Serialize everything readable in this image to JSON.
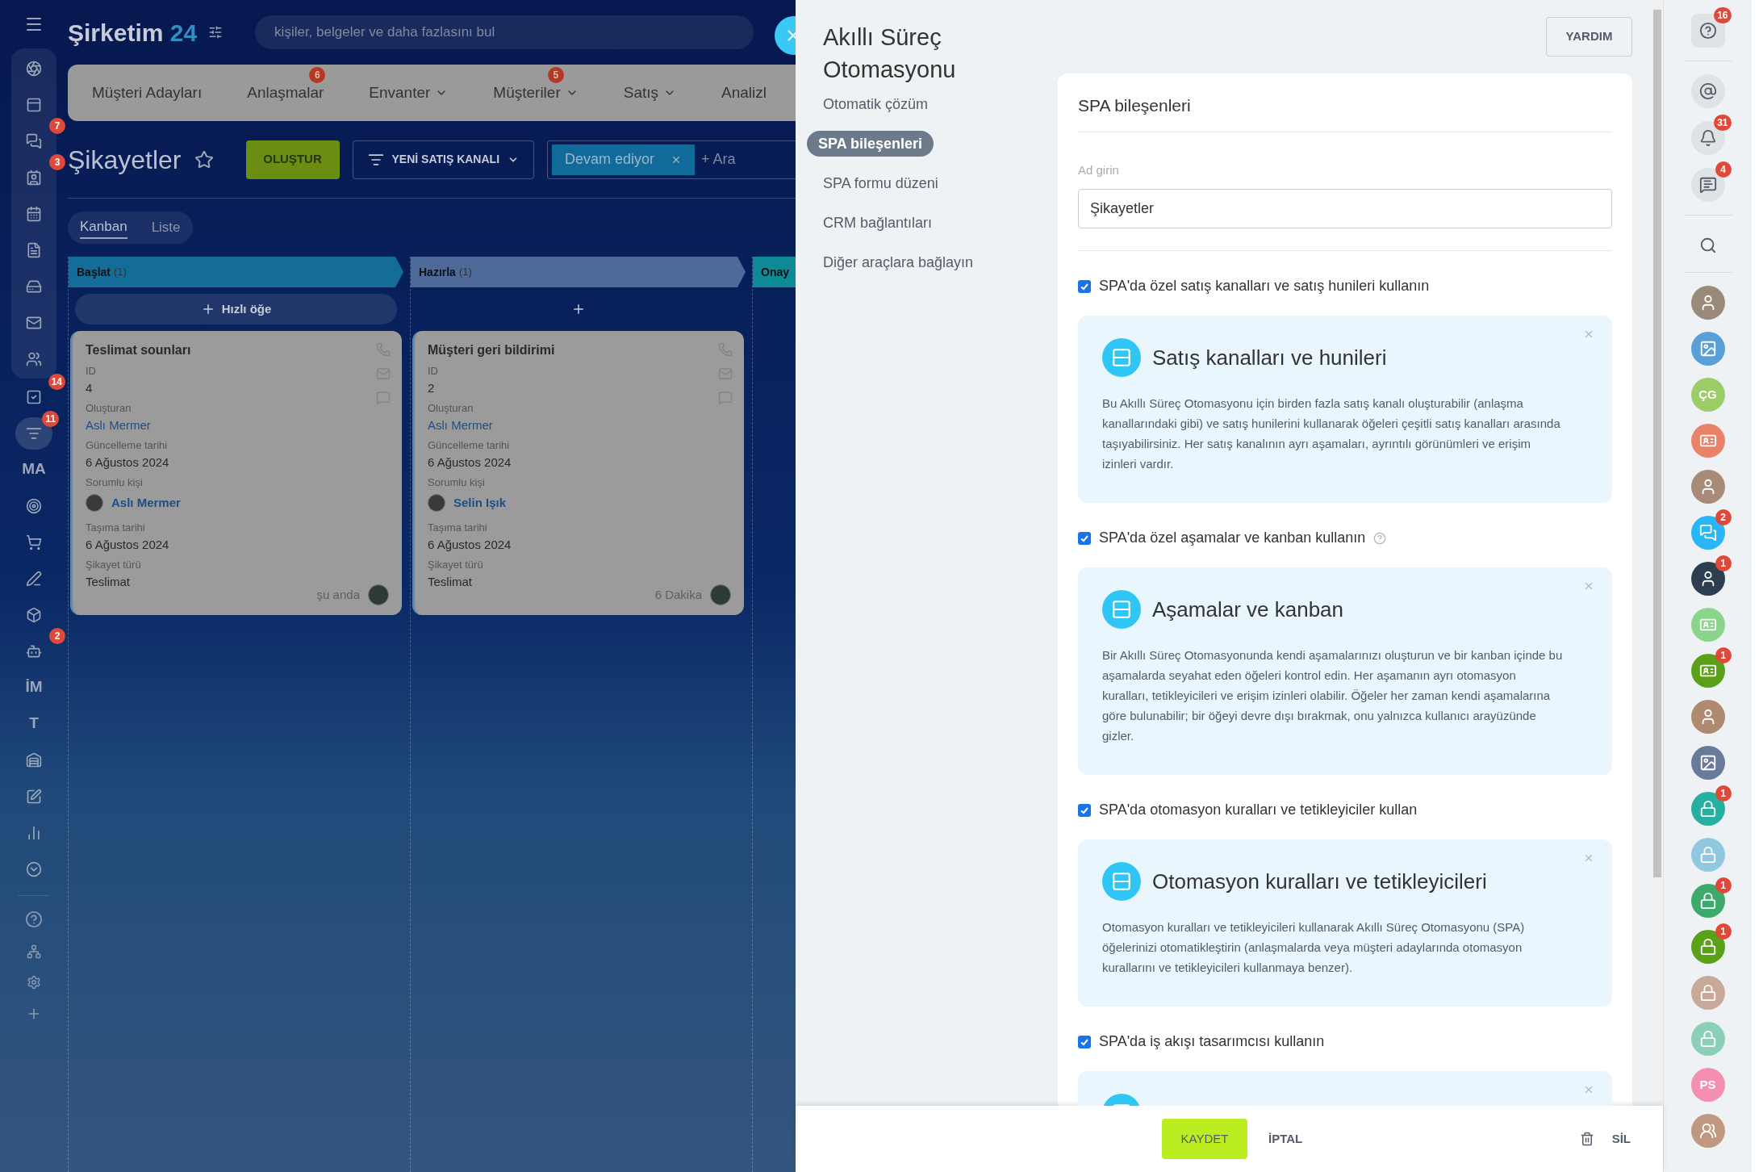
{
  "app": {
    "brand": {
      "name": "Şirketim",
      "number": "24"
    },
    "search": {
      "placeholder": "kişiler, belgeler ve daha fazlasını bul"
    },
    "left_nav": [
      {
        "kind": "icon",
        "selected": false
      },
      {
        "kind": "icon",
        "selected": false
      },
      {
        "kind": "icon",
        "badge": "7",
        "selected": false
      },
      {
        "kind": "icon",
        "badge": "3",
        "selected": false
      },
      {
        "kind": "icon",
        "selected": false
      },
      {
        "kind": "icon",
        "selected": false
      },
      {
        "kind": "icon",
        "selected": false
      },
      {
        "kind": "icon",
        "selected": false
      },
      {
        "kind": "icon",
        "selected": false
      },
      {
        "kind": "icon",
        "badge": "14",
        "selected": false
      },
      {
        "kind": "icon",
        "badge": "11",
        "selected": true
      },
      {
        "kind": "text",
        "text": "MA",
        "selected": false
      },
      {
        "kind": "icon",
        "selected": false
      },
      {
        "kind": "icon",
        "selected": false
      },
      {
        "kind": "icon",
        "selected": false
      },
      {
        "kind": "icon",
        "selected": false
      },
      {
        "kind": "icon",
        "badge": "2",
        "selected": false
      },
      {
        "kind": "text",
        "text": "İM",
        "selected": false
      },
      {
        "kind": "text",
        "text": "T",
        "selected": false
      },
      {
        "kind": "icon",
        "selected": false
      },
      {
        "kind": "icon",
        "selected": false
      },
      {
        "kind": "icon",
        "selected": false
      },
      {
        "kind": "icon",
        "selected": false
      }
    ],
    "top_menu": [
      {
        "label": "Müşteri Adayları",
        "dropdown": false
      },
      {
        "label": "Anlaşmalar",
        "badge": "6",
        "dropdown": false
      },
      {
        "label": "Envanter",
        "dropdown": true
      },
      {
        "label": "Müşteriler",
        "badge": "5",
        "dropdown": true
      },
      {
        "label": "Satış",
        "dropdown": true
      },
      {
        "label": "Analizl",
        "dropdown": false
      }
    ],
    "page_title": "Şikayetler",
    "create_button": "OLUŞTUR",
    "pipeline_button": "YENİ SATIŞ KANALI",
    "filter": {
      "chip": "Devam ediyor",
      "placeholder": "+ Ara"
    },
    "views": [
      {
        "label": "Kanban",
        "selected": true
      },
      {
        "label": "Liste",
        "selected": false
      }
    ],
    "columns": [
      {
        "title": "Başlat",
        "count": "(1)",
        "color": "#146c98",
        "quick_add": "Hızlı öğe",
        "cards": [
          {
            "title": "Teslimat sounları",
            "fields": [
              {
                "label": "ID",
                "value": "4",
                "kind": "text"
              },
              {
                "label": "Oluşturan",
                "value": "Aslı Mermer",
                "kind": "link"
              },
              {
                "label": "Güncelleme tarihi",
                "value": "6 Ağustos 2024",
                "kind": "text"
              },
              {
                "label": "Sorumlu kişi",
                "value": "Aslı Mermer",
                "kind": "person"
              },
              {
                "label": "Taşıma tarihi",
                "value": "6 Ağustos 2024",
                "kind": "text"
              },
              {
                "label": "Şikayet türü",
                "value": "Teslimat",
                "kind": "text"
              }
            ],
            "time": "şu anda"
          }
        ]
      },
      {
        "title": "Hazırla",
        "count": "(1)",
        "color": "#4d6a9a",
        "cards": [
          {
            "title": "Müşteri geri bildirimi",
            "fields": [
              {
                "label": "ID",
                "value": "2",
                "kind": "text"
              },
              {
                "label": "Oluşturan",
                "value": "Aslı Mermer",
                "kind": "link"
              },
              {
                "label": "Güncelleme tarihi",
                "value": "6 Ağustos 2024",
                "kind": "text"
              },
              {
                "label": "Sorumlu kişi",
                "value": "Selin Işık",
                "kind": "person"
              },
              {
                "label": "Taşıma tarihi",
                "value": "6 Ağustos 2024",
                "kind": "text"
              },
              {
                "label": "Şikayet türü",
                "value": "Teslimat",
                "kind": "text"
              }
            ],
            "time": "6 Dakika"
          }
        ]
      },
      {
        "title": "Onay",
        "color": "#0e8a96"
      }
    ]
  },
  "panel": {
    "title": "Akıllı Süreç Otomasyonu",
    "nav": [
      {
        "label": "Otomatik çözüm",
        "selected": false
      },
      {
        "label": "SPA bileşenleri",
        "selected": true
      },
      {
        "label": "SPA formu düzeni",
        "selected": false
      },
      {
        "label": "CRM bağlantıları",
        "selected": false
      },
      {
        "label": "Diğer araçlara bağlayın",
        "selected": false
      }
    ],
    "help_button": "YARDIM",
    "section_title": "SPA bileşenleri",
    "name_field": {
      "label": "Ad girin",
      "value": "Şikayetler"
    },
    "options": [
      {
        "label": "SPA'da özel satış kanalları ve satış hunileri kullanın",
        "checked": true,
        "help": false,
        "info": {
          "title": "Satış kanalları ve hunileri",
          "text": "Bu Akıllı Süreç Otomasyonu için birden fazla satış kanalı oluşturabilir (anlaşma kanallarındaki gibi) ve satış hunilerini kullanarak öğeleri çeşitli satış kanalları arasında taşıyabilirsiniz. Her satış kanalının ayrı aşamaları, ayrıntılı görünümleri ve erişim izinleri vardır."
        }
      },
      {
        "label": "SPA'da özel aşamalar ve kanban kullanın",
        "checked": true,
        "help": true,
        "info": {
          "title": "Aşamalar ve kanban",
          "text": "Bir Akıllı Süreç Otomasyonunda kendi aşamalarınızı oluşturun ve bir kanban içinde bu aşamalarda seyahat eden öğeleri kontrol edin. Her aşamanın ayrı otomasyon kuralları, tetikleyicileri ve erişim izinleri olabilir. Öğeler her zaman kendi aşamalarına göre bulunabilir; bir öğeyi devre dışı bırakmak, onu yalnızca kullanıcı arayüzünde gizler."
        }
      },
      {
        "label": "SPA'da otomasyon kuralları ve tetikleyiciler kullan",
        "checked": true,
        "help": false,
        "info": {
          "title": "Otomasyon kuralları ve tetikleyicileri",
          "text": "Otomasyon kuralları ve tetikleyicileri kullanarak Akıllı Süreç Otomasyonu (SPA) öğelerinizi otomatikleştirin (anlaşmalarda veya müşteri adaylarında otomasyon kurallarını ve tetikleyicileri kullanmaya benzer)."
        }
      },
      {
        "label": "SPA'da iş akışı tasarımcısı kullanın",
        "checked": true,
        "help": false,
        "info": {
          "partial": true
        }
      }
    ],
    "footer": {
      "save": "KAYDET",
      "cancel": "İPTAL",
      "delete": "SİL"
    }
  },
  "right_bar": {
    "top_badges": {
      "help": "16",
      "notifications": "31",
      "chats": "4"
    },
    "contacts": [
      {
        "kind": "avatar",
        "color": "#9a8a7a"
      },
      {
        "kind": "picture",
        "color": "#5aa0d8"
      },
      {
        "kind": "initials",
        "text": "ÇG",
        "color": "#9ccc65"
      },
      {
        "kind": "card",
        "color": "#e8836a"
      },
      {
        "kind": "avatar",
        "color": "#a88a78"
      },
      {
        "kind": "chat",
        "color": "#29b6f6",
        "badge": "2"
      },
      {
        "kind": "avatar",
        "color": "#2c3e50",
        "badge": "1"
      },
      {
        "kind": "card",
        "color": "#8bd48b"
      },
      {
        "kind": "card",
        "color": "#5aa018",
        "badge": "1"
      },
      {
        "kind": "avatar",
        "color": "#b08a70"
      },
      {
        "kind": "picture",
        "color": "#6a7a9a"
      },
      {
        "kind": "lock",
        "color": "#26b0a0",
        "badge": "1"
      },
      {
        "kind": "lock",
        "color": "#90c8e0"
      },
      {
        "kind": "lock",
        "color": "#3caa6a",
        "badge": "1"
      },
      {
        "kind": "lock",
        "color": "#5aa018",
        "badge": "1"
      },
      {
        "kind": "lock",
        "color": "#c8a898"
      },
      {
        "kind": "lock",
        "color": "#8ccfb8"
      },
      {
        "kind": "initials",
        "text": "PS",
        "color": "#f48fb1"
      },
      {
        "kind": "group",
        "color": "#c09880"
      }
    ]
  }
}
